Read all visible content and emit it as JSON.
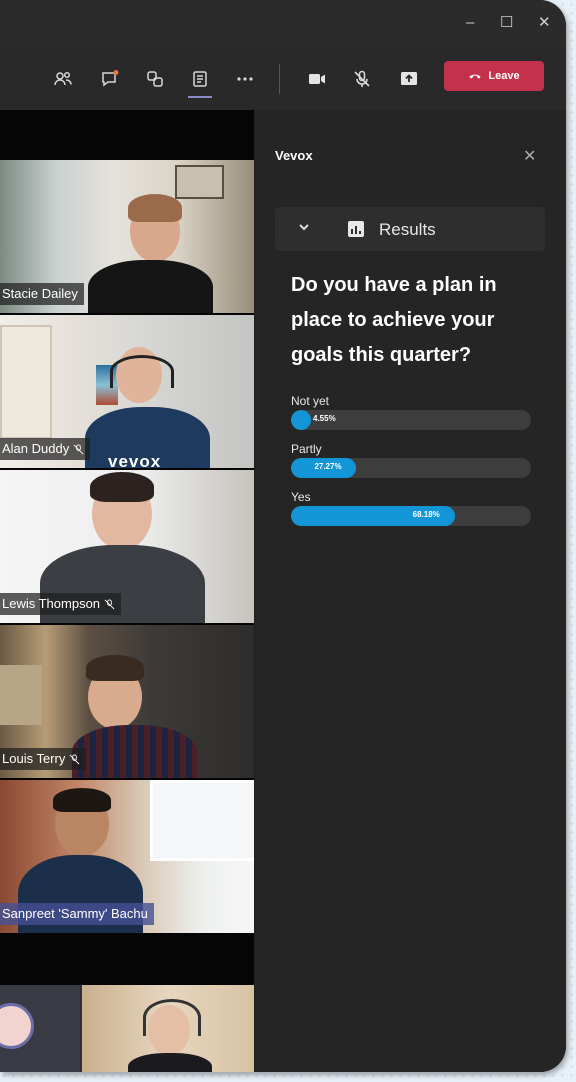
{
  "window": {
    "controls": {
      "minimize": "–",
      "maximize": "☐",
      "close": "✕"
    }
  },
  "toolbar": {
    "icons": [
      "people-icon",
      "chat-icon",
      "reactions-icon",
      "apps-icon",
      "more-icon",
      "camera-icon",
      "mic-off-icon",
      "share-icon"
    ],
    "leave_label": "Leave"
  },
  "participants": [
    {
      "name": "Stacie Dailey",
      "muted": false
    },
    {
      "name": "Alan Duddy",
      "muted": true
    },
    {
      "name": "Lewis Thompson",
      "muted": true
    },
    {
      "name": "Louis Terry",
      "muted": true
    },
    {
      "name": "Sanpreet 'Sammy' Bachu",
      "muted": false
    }
  ],
  "panel": {
    "title": "Vevox",
    "close_label": "✕",
    "results_label": "Results",
    "question": "Do you have a plan in place to achieve your goals this quarter?",
    "options": [
      {
        "label": "Not yet",
        "percent": 4.55,
        "percent_label": "4.55%"
      },
      {
        "label": "Partly",
        "percent": 27.27,
        "percent_label": "27.27%"
      },
      {
        "label": "Yes",
        "percent": 68.18,
        "percent_label": "68.18%"
      }
    ]
  },
  "colors": {
    "leave": "#c4314b",
    "bar_fill": "#1296d8",
    "bar_track": "#3d3d3d",
    "panel_bg": "#252525"
  }
}
